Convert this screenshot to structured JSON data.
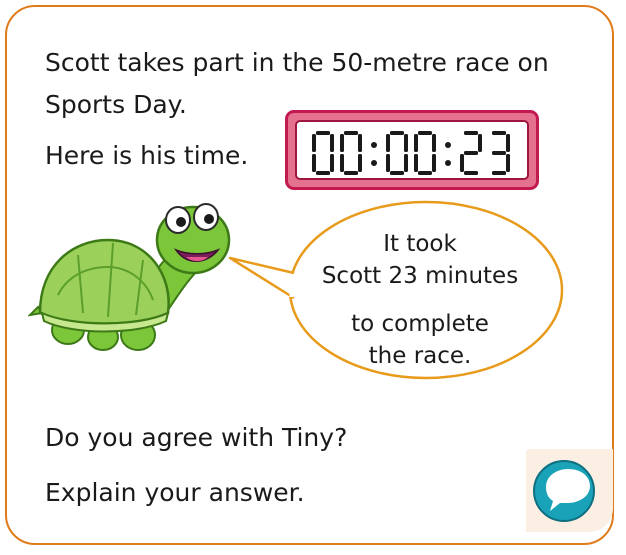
{
  "problem": {
    "line1": "Scott takes part in the 50-metre race on",
    "line2": "Sports Day.",
    "line3": "Here is his time."
  },
  "stopwatch": {
    "display": "00:00:23",
    "digits": [
      "0",
      "0",
      "0",
      "0",
      "2",
      "3"
    ]
  },
  "speech": {
    "lines": [
      "It took",
      "Scott 23 minutes",
      "to complete",
      "the race."
    ]
  },
  "questions": {
    "q1": "Do you agree with Tiny?",
    "q2": "Explain your answer."
  },
  "colors": {
    "border": "#e07b1a",
    "timer_frame": "#e4728f",
    "turtle_green": "#6cbf2a",
    "speech_icon": "#1aa3b8"
  },
  "icons": {
    "character": "turtle-icon",
    "discussion": "speech-bubble-icon"
  }
}
